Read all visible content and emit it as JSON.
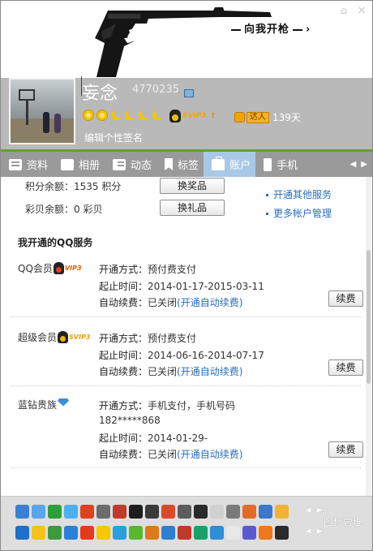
{
  "header": {
    "slogan": "向我开枪",
    "nickname": "妄念",
    "qq_number": "4770235",
    "svip_tag": "SVIP3",
    "daren_label": "达人",
    "daren_days": "139天",
    "signature_prompt": "编辑个性签名",
    "level_icons": [
      "sun",
      "sun",
      "moon",
      "moon",
      "moon",
      "moon"
    ]
  },
  "window_buttons": [
    "skin-icon",
    "close-icon"
  ],
  "tabs": [
    {
      "label": "资料",
      "icon": "profile-icon"
    },
    {
      "label": "相册",
      "icon": "album-icon"
    },
    {
      "label": "动态",
      "icon": "feed-icon"
    },
    {
      "label": "标签",
      "icon": "tag-icon"
    },
    {
      "label": "账户",
      "icon": "account-icon",
      "active": true
    },
    {
      "label": "手机",
      "icon": "phone-icon"
    }
  ],
  "account": {
    "points_label": "积分余额：",
    "points_value": "1535 积分",
    "points_button": "换奖品",
    "shells_label": "彩贝余额：",
    "shells_value": "0 彩贝",
    "shells_button": "换礼品",
    "links": [
      "开通其他服务",
      "更多帐户管理"
    ]
  },
  "services_title": "我开通的QQ服务",
  "services": [
    {
      "name": "QQ会员",
      "badge": "VIP3",
      "rows": [
        {
          "k": "开通方式：",
          "v": "预付费支付"
        },
        {
          "k": "起止时间：",
          "v": "2014-01-17-2015-03-11"
        },
        {
          "k": "自动续费：",
          "v": "已关闭",
          "action": "(开通自动续费)"
        }
      ],
      "button": "续费"
    },
    {
      "name": "超级会员",
      "badge": "SVIP3",
      "rows": [
        {
          "k": "开通方式：",
          "v": "预付费支付"
        },
        {
          "k": "起止时间：",
          "v": "2014-06-16-2014-07-17"
        },
        {
          "k": "自动续费：",
          "v": "已关闭",
          "action": "(开通自动续费)"
        }
      ],
      "button": "续费"
    },
    {
      "name": "蓝钻贵族",
      "badge": "",
      "rows": [
        {
          "k": "开通方式：",
          "v": "手机支付，手机号码"
        },
        {
          "k": "",
          "v": "182*****868"
        },
        {
          "k": "起止时间：",
          "v": "2014-01-29-"
        },
        {
          "k": "自动续费：",
          "v": "已关闭",
          "action": "(开通自动续费)"
        }
      ],
      "button": "续费"
    }
  ],
  "bottom": {
    "manage_label": "图标管理",
    "row1_colors": [
      "#3c7fd0",
      "#5aa5e8",
      "#2e9e3a",
      "#4cb0f0",
      "#e04020",
      "#6c6c6c",
      "#c23a2a",
      "#1e1e1e",
      "#3a3a3a",
      "#d94a2a",
      "#5c5c5c",
      "#2a2a2a",
      "#d0d0d0",
      "#7a7a7a",
      "#e46a2a",
      "#3a78c8",
      "#f2b233"
    ],
    "row2_colors": [
      "#1e6fc8",
      "#f4c21a",
      "#3c9a3c",
      "#2a80d8",
      "#e23a1a",
      "#f5c800",
      "#28a0e0",
      "#58b830",
      "#dd7a1a",
      "#2e7fd0",
      "#c0392b",
      "#1aa06a",
      "#2c8fd8",
      "#e8e8e8",
      "#5a5ad0",
      "#f07818",
      "#2a2a2a"
    ]
  }
}
